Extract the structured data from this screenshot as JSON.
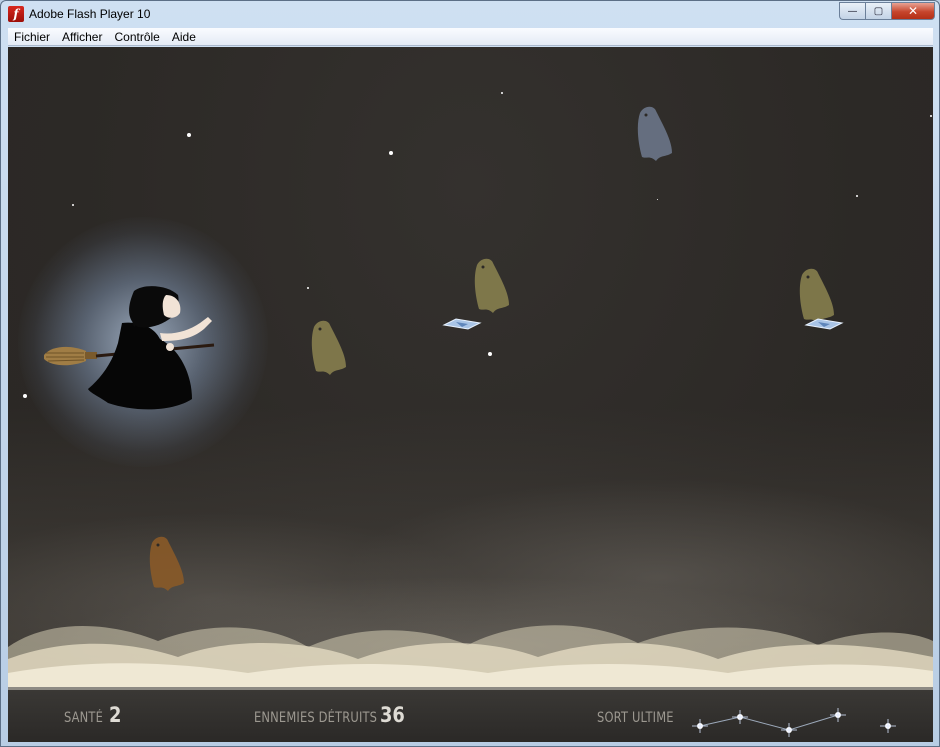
{
  "window": {
    "title": "Adobe Flash Player 10",
    "icon": "flash-player-icon",
    "icon_glyph": "f",
    "buttons": {
      "minimize": "—",
      "maximize": "▢",
      "close": "✕"
    }
  },
  "menu": {
    "items": [
      "Fichier",
      "Afficher",
      "Contrôle",
      "Aide"
    ]
  },
  "hud": {
    "health_label": "SANTÉ",
    "health_value": "2",
    "kills_label": "ENNEMIES DÉTRUITS",
    "kills_value": "36",
    "ultimate_label": "SORT ULTIME"
  },
  "colors": {
    "sky": "#2c2926",
    "ghost_olive": "#8c8450",
    "ghost_blue": "#6e7a8e",
    "ghost_brown": "#8a5a28",
    "hud_text": "#9c9890",
    "hud_value": "#dedbd4"
  }
}
